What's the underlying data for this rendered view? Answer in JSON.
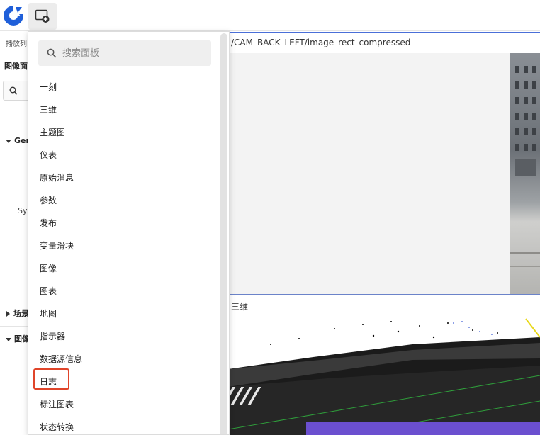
{
  "toolbar": {
    "add_panel_icon": "add-panel-icon",
    "logo_icon": "app-logo-icon",
    "brand_color": "#1f5fd9"
  },
  "sidebar": {
    "playlist_label": "播放列",
    "image_panel_label": "图像面",
    "search_icon": "search-icon",
    "general_label": "Gen",
    "sy_label": "Sy",
    "scene_label": "场景",
    "image_label": "图像"
  },
  "image_panel": {
    "topic": "/CAM_BACK_LEFT/image_rect_compressed"
  },
  "three_panel": {
    "title": "三维"
  },
  "dropdown": {
    "search_placeholder": "搜索面板",
    "items": [
      "一刻",
      "三维",
      "主题图",
      "仪表",
      "原始消息",
      "参数",
      "发布",
      "变量滑块",
      "图像",
      "图表",
      "地图",
      "指示器",
      "数据源信息",
      "日志",
      "标注图表",
      "状态转换"
    ],
    "highlighted_item": "日志",
    "highlight_color": "#e0452a"
  }
}
